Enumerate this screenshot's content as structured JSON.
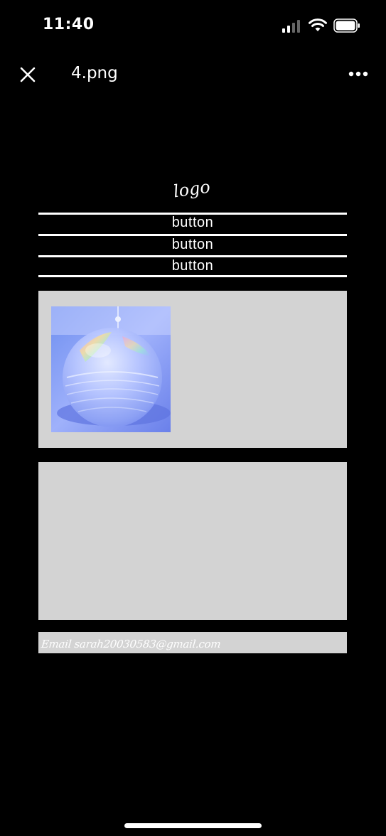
{
  "status_bar": {
    "time": "11:40"
  },
  "nav": {
    "file_name": "4.png",
    "close_icon": "close-icon",
    "more_icon": "more-icon"
  },
  "site": {
    "logo": "logo",
    "buttons": [
      "button",
      "button",
      "button"
    ],
    "email": "Email sarah20030583@gmail.com"
  },
  "colors": {
    "background": "#000000",
    "panel": "#d3d3d3",
    "text": "#ffffff"
  }
}
